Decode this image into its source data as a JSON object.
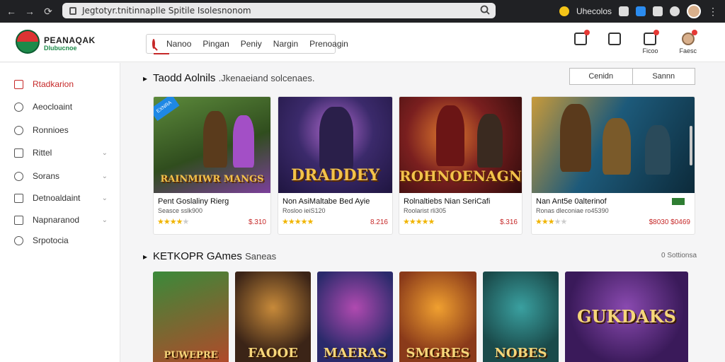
{
  "browser": {
    "url": "Jegtotyr.tnitinnaplle  Spitile Isolesnonom",
    "profile_name": "Uhecolos"
  },
  "header": {
    "logo_title": "PEANAQAK",
    "logo_subtitle": "Dlubucnoe",
    "search_tabs": [
      "Nanoo",
      "Pingan",
      "Peniy",
      "Nargin",
      "Prenoagin"
    ],
    "icons": [
      {
        "icon": "notification-icon",
        "label": "",
        "dot": true
      },
      {
        "icon": "bookmark-icon",
        "label": "",
        "dot": false
      },
      {
        "icon": "person-icon",
        "label": "Ficoo",
        "dot": true
      },
      {
        "icon": "avatar-icon",
        "label": "Faesc",
        "dot": true
      }
    ]
  },
  "sidebar": {
    "items": [
      {
        "label": "Rtadkarion",
        "icon": "square-icon",
        "active": true,
        "chevron": false
      },
      {
        "label": "Aeocloaint",
        "icon": "circle-icon",
        "active": false,
        "chevron": false
      },
      {
        "label": "Ronnioes",
        "icon": "search-icon",
        "active": false,
        "chevron": false
      },
      {
        "label": "Rittel",
        "icon": "chart-icon",
        "active": false,
        "chevron": true
      },
      {
        "label": "Sorans",
        "icon": "gamepad-icon",
        "active": false,
        "chevron": true
      },
      {
        "label": "Detnoaldaint",
        "icon": "bag-icon",
        "active": false,
        "chevron": true
      },
      {
        "label": "Napnaranod",
        "icon": "square-icon",
        "active": false,
        "chevron": true
      },
      {
        "label": "Srpotocia",
        "icon": "circle-icon",
        "active": false,
        "chevron": false
      }
    ]
  },
  "section1": {
    "title": "Taodd Aolnils",
    "subtitle": ".Jkenaeiand solcenaes.",
    "filters": [
      "Cenidn",
      "Sannn"
    ],
    "cards": [
      {
        "title": "Pent Goslaliny Rierg",
        "meta": "Seasce sslk900",
        "stars": 4,
        "price": "$.310",
        "art": "RAINMIWR MANGS",
        "ribbon": "EXNRA",
        "colors": [
          "#6a9a3a",
          "#2f4f1d",
          "#8b4bb8"
        ]
      },
      {
        "title": "Non AsiMaltabe Bed Ayie",
        "meta": "Rosloo ieiS120",
        "stars": 5,
        "price": "8.216",
        "art": "DRADDEY",
        "ribbon": "",
        "colors": [
          "#3b2a6b",
          "#1f1540",
          "#c06bd0"
        ]
      },
      {
        "title": "Rolnaltiebs Nian SeriCafi",
        "meta": "Roolarist rli305",
        "stars": 5,
        "price": "$.316",
        "art": "ROHNOENAGN",
        "ribbon": "",
        "colors": [
          "#7a1f1f",
          "#2e0b0b",
          "#e07a2e"
        ]
      },
      {
        "title": "Nan Ant5e 0alterinof",
        "meta": "Ronas dleconiae ro45390",
        "stars": 3,
        "price": "$8030  $0469",
        "art": "",
        "ribbon": "",
        "colors": [
          "#1d5a7a",
          "#0c2a3a",
          "#c8a03a"
        ]
      }
    ]
  },
  "section2": {
    "title": "KETKOPR GAmes",
    "subtitle": "Saneas",
    "right_label": "0 Sottionsa",
    "tiles": [
      {
        "label": "PUWEPRE",
        "colors": [
          "#3a8a3a",
          "#b04a2a"
        ]
      },
      {
        "label": "FAOOE",
        "colors": [
          "#3b2417",
          "#c78a3a"
        ]
      },
      {
        "label": "MAERAS",
        "colors": [
          "#2a2a6b",
          "#b04ab0"
        ]
      },
      {
        "label": "SMGRES",
        "colors": [
          "#8a3a1a",
          "#f0a030"
        ]
      },
      {
        "label": "NOBES",
        "colors": [
          "#1a4a4a",
          "#3aa0a0"
        ]
      },
      {
        "label": "GUKDAKS",
        "colors": [
          "#3a1a5a",
          "#d0a020"
        ]
      }
    ]
  }
}
